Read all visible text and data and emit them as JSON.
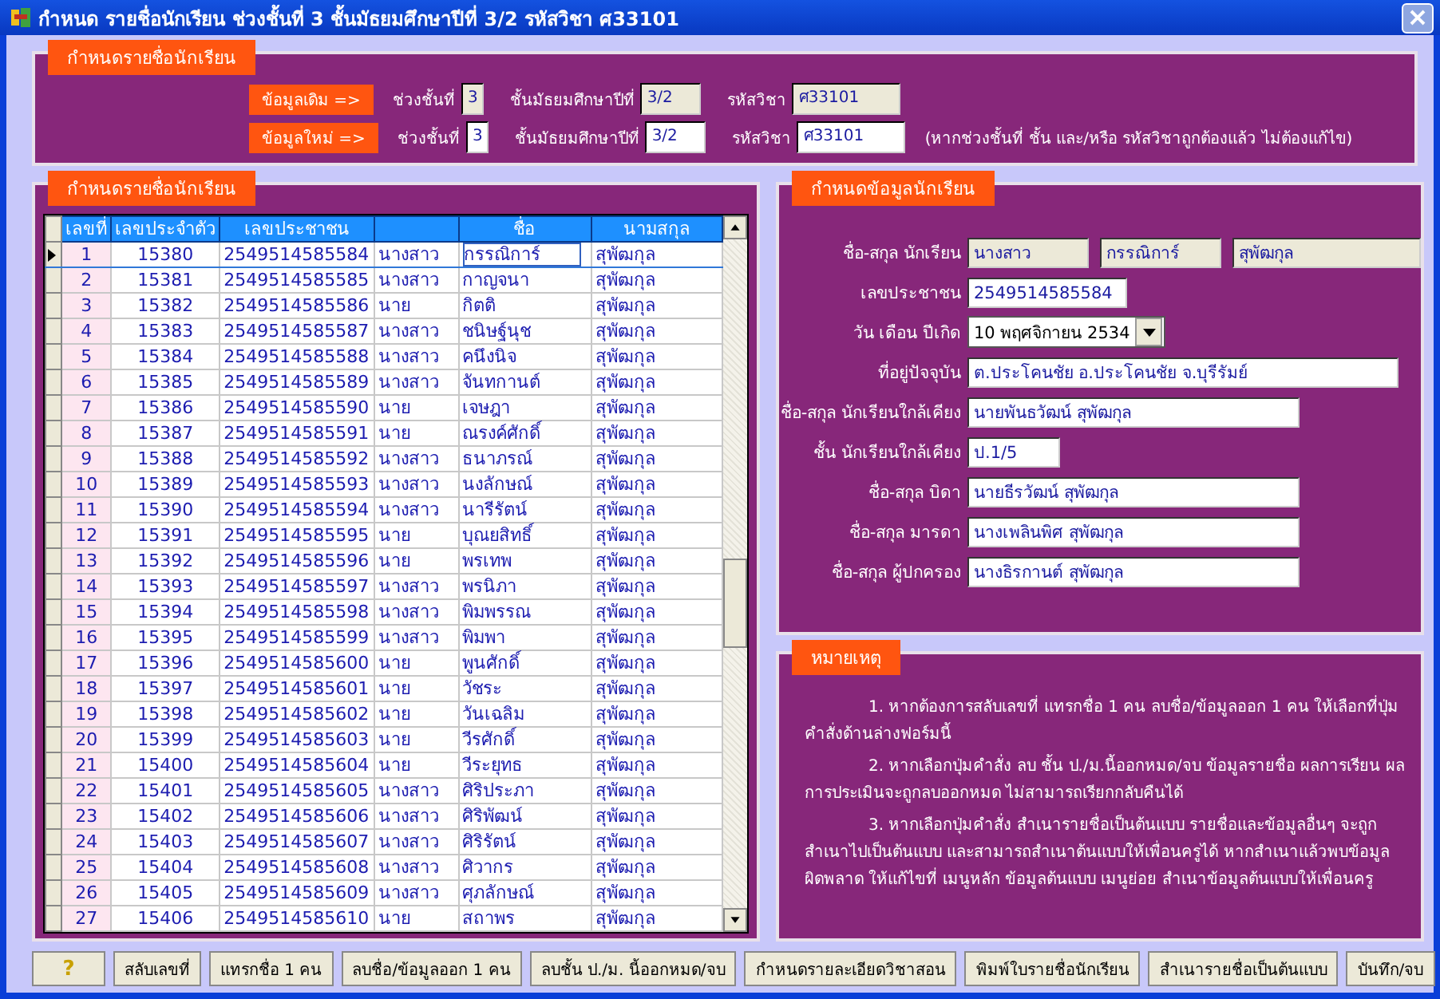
{
  "window": {
    "title": "กำหนด รายชื่อนักเรียน ช่วงชั้นที่ 3 ชั้นมัธยมศึกษาปีที่ 3/2 รหัสวิชา ศ33101"
  },
  "setup": {
    "legend": "กำหนดรายชื่อนักเรียน",
    "rows": [
      {
        "button": "ข้อมูลเดิม =>",
        "readonly": true,
        "fields": [
          {
            "label": "ช่วงชั้นที่",
            "value": "3"
          },
          {
            "label": "ชั้นมัธยมศึกษาปีที่",
            "value": "3/2"
          },
          {
            "label": "รหัสวิชา",
            "value": "ศ33101"
          }
        ]
      },
      {
        "button": "ข้อมูลใหม่ =>",
        "readonly": false,
        "fields": [
          {
            "label": "ช่วงชั้นที่",
            "value": "3"
          },
          {
            "label": "ชั้นมัธยมศึกษาปีที่",
            "value": "3/2"
          },
          {
            "label": "รหัสวิชา",
            "value": "ศ33101"
          }
        ],
        "note": "(หากช่วงชั้นที่ ชั้น และ/หรือ รหัสวิชาถูกต้องแล้ว ไม่ต้องแก้ไข)"
      }
    ]
  },
  "students": {
    "legend": "กำหนดรายชื่อนักเรียน",
    "columns": [
      "เลขที่",
      "เลขประจำตัว",
      "เลขประชาชน",
      "ชื่อ",
      "นามสกุล"
    ],
    "rows": [
      {
        "no": "1",
        "id": "15380",
        "citizen": "2549514585584",
        "prefix": "นางสาว",
        "first": "กรรณิการ์",
        "last": "สุพัฒกุล",
        "selected": true
      },
      {
        "no": "2",
        "id": "15381",
        "citizen": "2549514585585",
        "prefix": "นางสาว",
        "first": "กาญจนา",
        "last": "สุพัฒกุล",
        "selected": false
      },
      {
        "no": "3",
        "id": "15382",
        "citizen": "2549514585586",
        "prefix": "นาย",
        "first": "กิตติ",
        "last": "สุพัฒกุล",
        "selected": false
      },
      {
        "no": "4",
        "id": "15383",
        "citizen": "2549514585587",
        "prefix": "นางสาว",
        "first": "ชนิษฐ์นุช",
        "last": "สุพัฒกุล",
        "selected": false
      },
      {
        "no": "5",
        "id": "15384",
        "citizen": "2549514585588",
        "prefix": "นางสาว",
        "first": "คนึงนิจ",
        "last": "สุพัฒกุล",
        "selected": false
      },
      {
        "no": "6",
        "id": "15385",
        "citizen": "2549514585589",
        "prefix": "นางสาว",
        "first": "จันทกานต์",
        "last": "สุพัฒกุล",
        "selected": false
      },
      {
        "no": "7",
        "id": "15386",
        "citizen": "2549514585590",
        "prefix": "นาย",
        "first": "เจษฎา",
        "last": "สุพัฒกุล",
        "selected": false
      },
      {
        "no": "8",
        "id": "15387",
        "citizen": "2549514585591",
        "prefix": "นาย",
        "first": "ณรงค์ศักดิ์",
        "last": "สุพัฒกุล",
        "selected": false
      },
      {
        "no": "9",
        "id": "15388",
        "citizen": "2549514585592",
        "prefix": "นางสาว",
        "first": "ธนาภรณ์",
        "last": "สุพัฒกุล",
        "selected": false
      },
      {
        "no": "10",
        "id": "15389",
        "citizen": "2549514585593",
        "prefix": "นางสาว",
        "first": "นงลักษณ์",
        "last": "สุพัฒกุล",
        "selected": false
      },
      {
        "no": "11",
        "id": "15390",
        "citizen": "2549514585594",
        "prefix": "นางสาว",
        "first": "นารีรัตน์",
        "last": "สุพัฒกุล",
        "selected": false
      },
      {
        "no": "12",
        "id": "15391",
        "citizen": "2549514585595",
        "prefix": "นาย",
        "first": "บุณยสิทธิ์",
        "last": "สุพัฒกุล",
        "selected": false
      },
      {
        "no": "13",
        "id": "15392",
        "citizen": "2549514585596",
        "prefix": "นาย",
        "first": "พรเทพ",
        "last": "สุพัฒกุล",
        "selected": false
      },
      {
        "no": "14",
        "id": "15393",
        "citizen": "2549514585597",
        "prefix": "นางสาว",
        "first": "พรนิภา",
        "last": "สุพัฒกุล",
        "selected": false
      },
      {
        "no": "15",
        "id": "15394",
        "citizen": "2549514585598",
        "prefix": "นางสาว",
        "first": "พิมพรรณ",
        "last": "สุพัฒกุล",
        "selected": false
      },
      {
        "no": "16",
        "id": "15395",
        "citizen": "2549514585599",
        "prefix": "นางสาว",
        "first": "พิมพา",
        "last": "สุพัฒกุล",
        "selected": false
      },
      {
        "no": "17",
        "id": "15396",
        "citizen": "2549514585600",
        "prefix": "นาย",
        "first": "พูนศักดิ์",
        "last": "สุพัฒกุล",
        "selected": false
      },
      {
        "no": "18",
        "id": "15397",
        "citizen": "2549514585601",
        "prefix": "นาย",
        "first": "วัชระ",
        "last": "สุพัฒกุล",
        "selected": false
      },
      {
        "no": "19",
        "id": "15398",
        "citizen": "2549514585602",
        "prefix": "นาย",
        "first": "วันเฉลิม",
        "last": "สุพัฒกุล",
        "selected": false
      },
      {
        "no": "20",
        "id": "15399",
        "citizen": "2549514585603",
        "prefix": "นาย",
        "first": "วีรศักดิ์",
        "last": "สุพัฒกุล",
        "selected": false
      },
      {
        "no": "21",
        "id": "15400",
        "citizen": "2549514585604",
        "prefix": "นาย",
        "first": "วีระยุทธ",
        "last": "สุพัฒกุล",
        "selected": false
      },
      {
        "no": "22",
        "id": "15401",
        "citizen": "2549514585605",
        "prefix": "นางสาว",
        "first": "ศิริประภา",
        "last": "สุพัฒกุล",
        "selected": false
      },
      {
        "no": "23",
        "id": "15402",
        "citizen": "2549514585606",
        "prefix": "นางสาว",
        "first": "ศิริพัฒน์",
        "last": "สุพัฒกุล",
        "selected": false
      },
      {
        "no": "24",
        "id": "15403",
        "citizen": "2549514585607",
        "prefix": "นางสาว",
        "first": "ศิริรัตน์",
        "last": "สุพัฒกุล",
        "selected": false
      },
      {
        "no": "25",
        "id": "15404",
        "citizen": "2549514585608",
        "prefix": "นางสาว",
        "first": "ศิวากร",
        "last": "สุพัฒกุล",
        "selected": false
      },
      {
        "no": "26",
        "id": "15405",
        "citizen": "2549514585609",
        "prefix": "นางสาว",
        "first": "ศุภลักษณ์",
        "last": "สุพัฒกุล",
        "selected": false
      },
      {
        "no": "27",
        "id": "15406",
        "citizen": "2549514585610",
        "prefix": "นาย",
        "first": "สถาพร",
        "last": "สุพัฒกุล",
        "selected": false
      }
    ]
  },
  "details": {
    "legend": "กำหนดข้อมูลนักเรียน",
    "fields": [
      {
        "label": "ชื่อ-สกุล นักเรียน",
        "kind": "readonly",
        "values": [
          "นางสาว",
          "กรรณิการ์",
          "สุพัฒกุล"
        ]
      },
      {
        "label": "เลขประชาชน",
        "kind": "text",
        "values": [
          "2549514585584"
        ]
      },
      {
        "label": "วัน เดือน ปีเกิด",
        "kind": "dropdown",
        "values": [
          "10 พฤศจิกายน 2534"
        ]
      },
      {
        "label": "ที่อยู่ปัจจุบัน",
        "kind": "text",
        "values": [
          "ต.ประโคนชัย อ.ประโคนชัย จ.บุรีรัมย์"
        ]
      },
      {
        "label": "ชื่อ-สกุล นักเรียนใกล้เคียง",
        "kind": "text",
        "values": [
          "นายพันธวัฒน์ สุพัฒกุล"
        ]
      },
      {
        "label": "ชั้น นักเรียนใกล้เคียง",
        "kind": "text",
        "values": [
          "ป.1/5"
        ]
      },
      {
        "label": "ชื่อ-สกุล บิดา",
        "kind": "text",
        "values": [
          "นายธีรวัฒน์ สุพัฒกุล"
        ]
      },
      {
        "label": "ชื่อ-สกุล มารดา",
        "kind": "text",
        "values": [
          "นางเพลินพิศ สุพัฒกุล"
        ]
      },
      {
        "label": "ชื่อ-สกุล ผู้ปกครอง",
        "kind": "text",
        "values": [
          "นางธิรกานต์ สุพัฒกุล"
        ]
      }
    ]
  },
  "notes": {
    "legend": "หมายเหตุ",
    "paragraphs": [
      "1. หากต้องการสลับเลขที่ แทรกชื่อ 1 คน ลบชื่อ/ข้อมูลออก 1 คน ให้เลือกที่ปุ่มคำสั่งด้านล่างฟอร์มนี้",
      "2. หากเลือกปุ่มคำสั่ง ลบ ชั้น ป./ม.นี้ออกหมด/จบ ข้อมูลรายชื่อ ผลการเรียน ผลการประเมินจะถูกลบออกหมด ไม่สามารถเรียกกลับคืนได้",
      "3. หากเลือกปุ่มคำสั่ง สำเนารายชื่อเป็นต้นแบบ รายชื่อและข้อมูลอื่นๆ จะถูกสำเนาไปเป็นต้นแบบ และสามารถสำเนาต้นแบบให้เพื่อนครูได้ หากสำเนาแล้วพบข้อมูลผิดพลาด  ให้แก้ไขที่ เมนูหลัก ข้อมูลต้นแบบ เมนูย่อย สำเนาข้อมูลต้นแบบให้เพื่อนครู"
    ]
  },
  "buttons": [
    {
      "label": "?",
      "kind": "help"
    },
    {
      "label": "สลับเลขที่",
      "kind": "text"
    },
    {
      "label": "แทรกชื่อ 1 คน",
      "kind": "text"
    },
    {
      "label": "ลบชื่อ/ข้อมูลออก 1 คน",
      "kind": "text"
    },
    {
      "label": "ลบชั้น ป./ม. นี้ออกหมด/จบ",
      "kind": "text"
    },
    {
      "label": "กำหนดรายละเอียดวิชาสอน",
      "kind": "text"
    },
    {
      "label": "พิมพ์ใบรายชื่อนักเรียน",
      "kind": "text"
    },
    {
      "label": "สำเนารายชื่อเป็นต้นแบบ",
      "kind": "text"
    },
    {
      "label": "บันทึก/จบ",
      "kind": "text"
    }
  ]
}
